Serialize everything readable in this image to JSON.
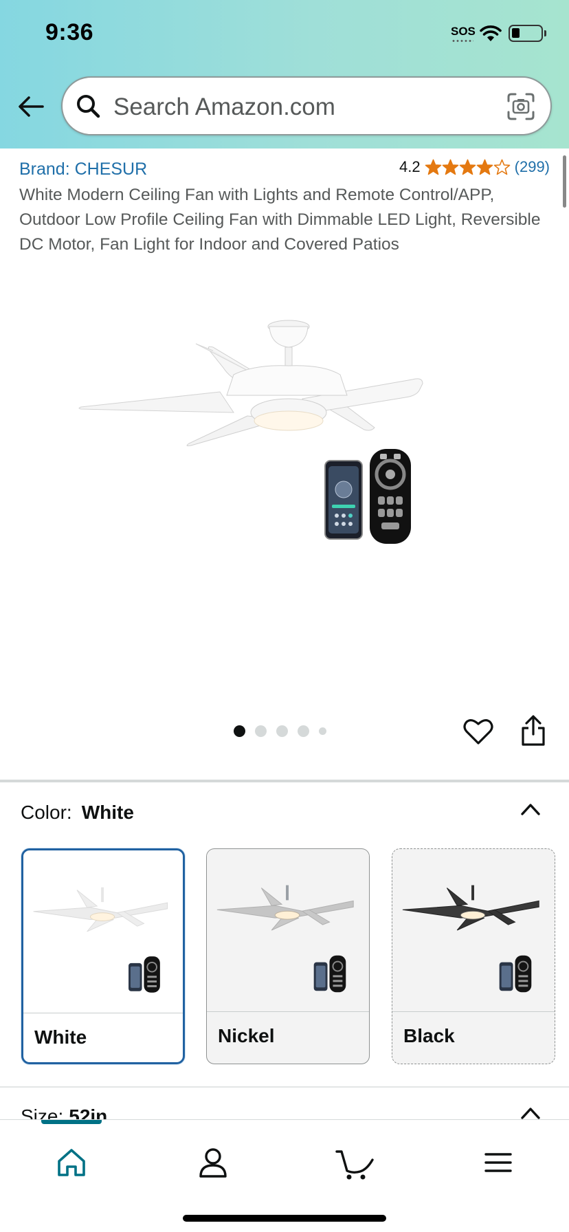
{
  "status_bar": {
    "time": "9:36",
    "sos": "SOS"
  },
  "search": {
    "placeholder": "Search Amazon.com"
  },
  "product": {
    "brand": "Brand: CHESUR",
    "rating": "4.2",
    "rating_stars": 4.2,
    "rating_count": "(299)",
    "title": "White Modern Ceiling Fan with Lights and Remote Control/APP, Outdoor Low Profile Ceiling Fan with Dimmable LED Light, Reversible DC Motor, Fan Light for Indoor and Covered Patios",
    "image_count": 5,
    "current_image": 1
  },
  "color_section": {
    "label": "Color:",
    "selected": "White",
    "options": [
      {
        "label": "White",
        "state": "selected"
      },
      {
        "label": "Nickel",
        "state": "available"
      },
      {
        "label": "Black",
        "state": "unavailable"
      }
    ]
  },
  "size_section": {
    "label": "Size:",
    "selected": "52in"
  },
  "bottom_nav": {
    "items": [
      "home-icon",
      "account-icon",
      "cart-icon",
      "menu-icon"
    ],
    "active": "home-icon"
  },
  "colors": {
    "link": "#1f6fa9",
    "star": "#e47911",
    "accent": "#007185",
    "selected_border": "#2162a1"
  }
}
